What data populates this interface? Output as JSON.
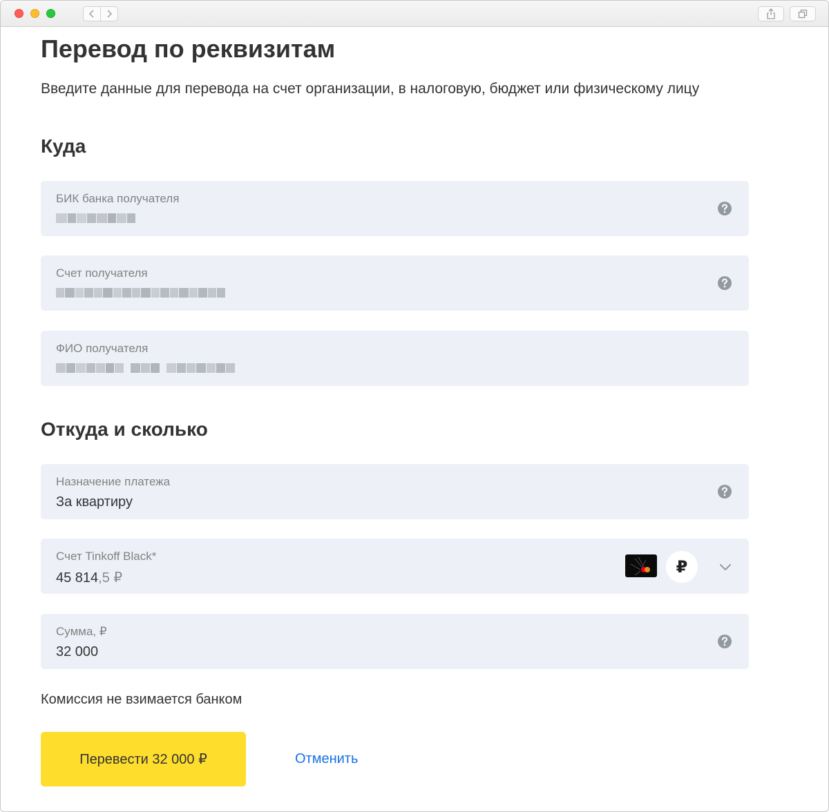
{
  "page": {
    "title": "Перевод по реквизитам",
    "subtitle": "Введите данные для перевода на счет организации, в налоговую, бюджет или физическому лицу"
  },
  "to_section": {
    "title": "Куда",
    "bik": {
      "label": "БИК банка получателя",
      "value_state": "blurred"
    },
    "account": {
      "label": "Счет получателя",
      "value_state": "blurred"
    },
    "name": {
      "label": "ФИО получателя",
      "value_state": "blurred"
    }
  },
  "from_section": {
    "title": "Откуда и сколько",
    "purpose": {
      "label": "Назначение платежа",
      "value": "За квартиру"
    },
    "source": {
      "label": "Счет Tinkoff Black*",
      "balance_main": "45 814",
      "balance_decimal": ",5 ₽",
      "currency_symbol": "₽"
    },
    "amount": {
      "label": "Сумма, ₽",
      "value": "32 000"
    }
  },
  "commission_text": "Комиссия не взимается банком",
  "actions": {
    "submit_label": "Перевести 32 000 ₽",
    "cancel_label": "Отменить"
  },
  "colors": {
    "accent_yellow": "#ffdd2d",
    "field_bg": "#edf1f7",
    "link_blue": "#1771e6",
    "label_gray": "#818181",
    "icon_gray": "#9299a2"
  },
  "icons": {
    "help": "question-circle-icon",
    "dropdown": "chevron-down-icon",
    "card": "bank-card-icon",
    "currency": "ruble-icon"
  }
}
